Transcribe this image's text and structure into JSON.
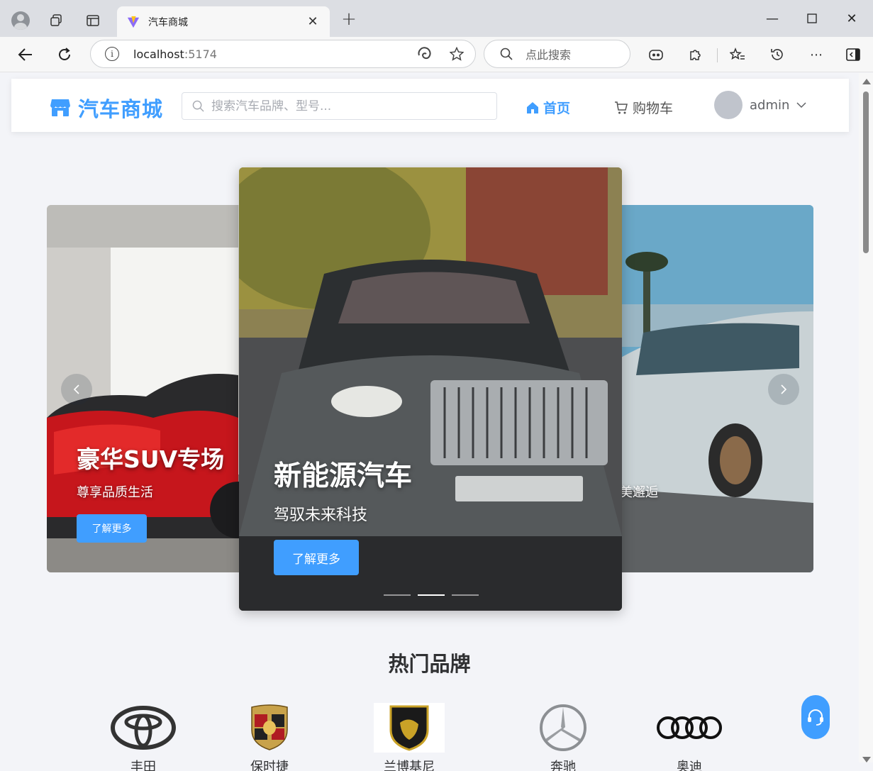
{
  "browser": {
    "tab_title": "汽车商城",
    "address_host": "localhost",
    "address_port": ":5174",
    "search_placeholder": "点此搜索"
  },
  "site": {
    "logo_text": "汽车商城",
    "search_placeholder": "搜索汽车品牌、型号...",
    "nav_home": "首页",
    "nav_cart": "购物车",
    "username": "admin",
    "accent_color": "#409eff"
  },
  "carousel": {
    "slides": [
      {
        "title": "豪华SUV专场",
        "subtitle": "尊享品质生活",
        "button": "了解更多"
      },
      {
        "title": "新能源汽车",
        "subtitle": "驾驭未来科技",
        "button": "了解更多"
      },
      {
        "subtitle_fragment": "美邂逅"
      }
    ],
    "active_index": 1,
    "indicator_count": 3
  },
  "brands": {
    "title": "热门品牌",
    "items": [
      {
        "name": "丰田",
        "icon": "toyota-logo"
      },
      {
        "name": "保时捷",
        "icon": "porsche-logo"
      },
      {
        "name": "兰博基尼",
        "icon": "lamborghini-logo"
      },
      {
        "name": "奔驰",
        "icon": "mercedes-logo"
      },
      {
        "name": "奥迪",
        "icon": "audi-logo"
      }
    ]
  }
}
